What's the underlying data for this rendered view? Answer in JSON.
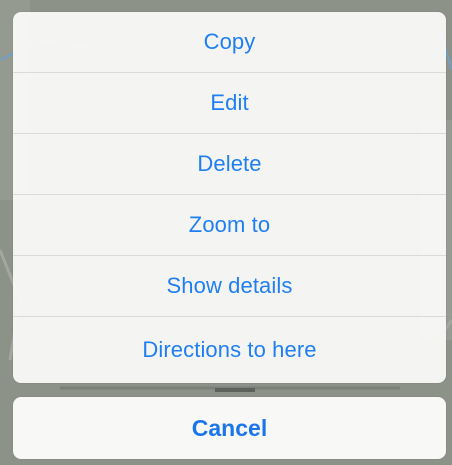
{
  "action_sheet": {
    "items": [
      {
        "label": "Copy"
      },
      {
        "label": "Edit"
      },
      {
        "label": "Delete"
      },
      {
        "label": "Zoom to"
      },
      {
        "label": "Show details"
      },
      {
        "label": "Directions to here"
      }
    ],
    "cancel_label": "Cancel",
    "accent_color": "#1f7ff2"
  }
}
